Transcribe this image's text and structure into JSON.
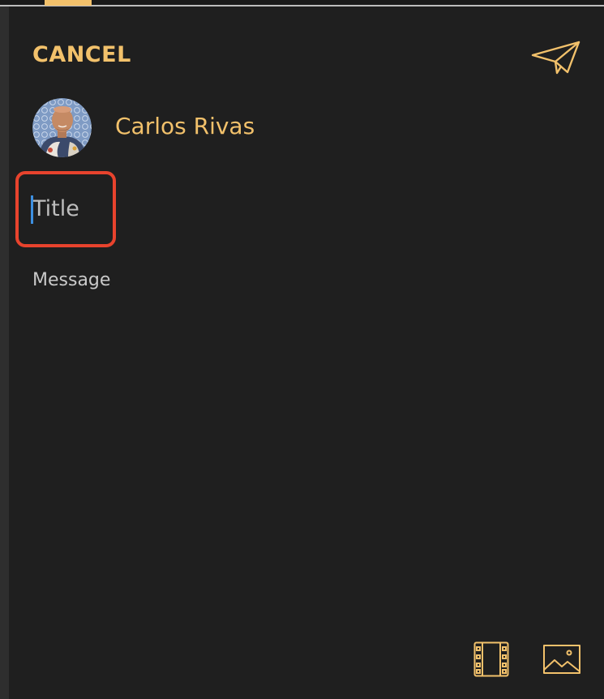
{
  "header": {
    "cancel_label": "CANCEL",
    "send_icon": "paper-plane-icon"
  },
  "author": {
    "name": "Carlos Rivas",
    "avatar_icon": "avatar"
  },
  "form": {
    "title_placeholder": "Title",
    "message_placeholder": "Message"
  },
  "toolbar": {
    "video_icon": "film-icon",
    "image_icon": "image-icon"
  },
  "colors": {
    "accent": "#f2c16b",
    "background": "#1f1f1f",
    "highlight": "#e8432d",
    "caret": "#3d8fe0"
  }
}
